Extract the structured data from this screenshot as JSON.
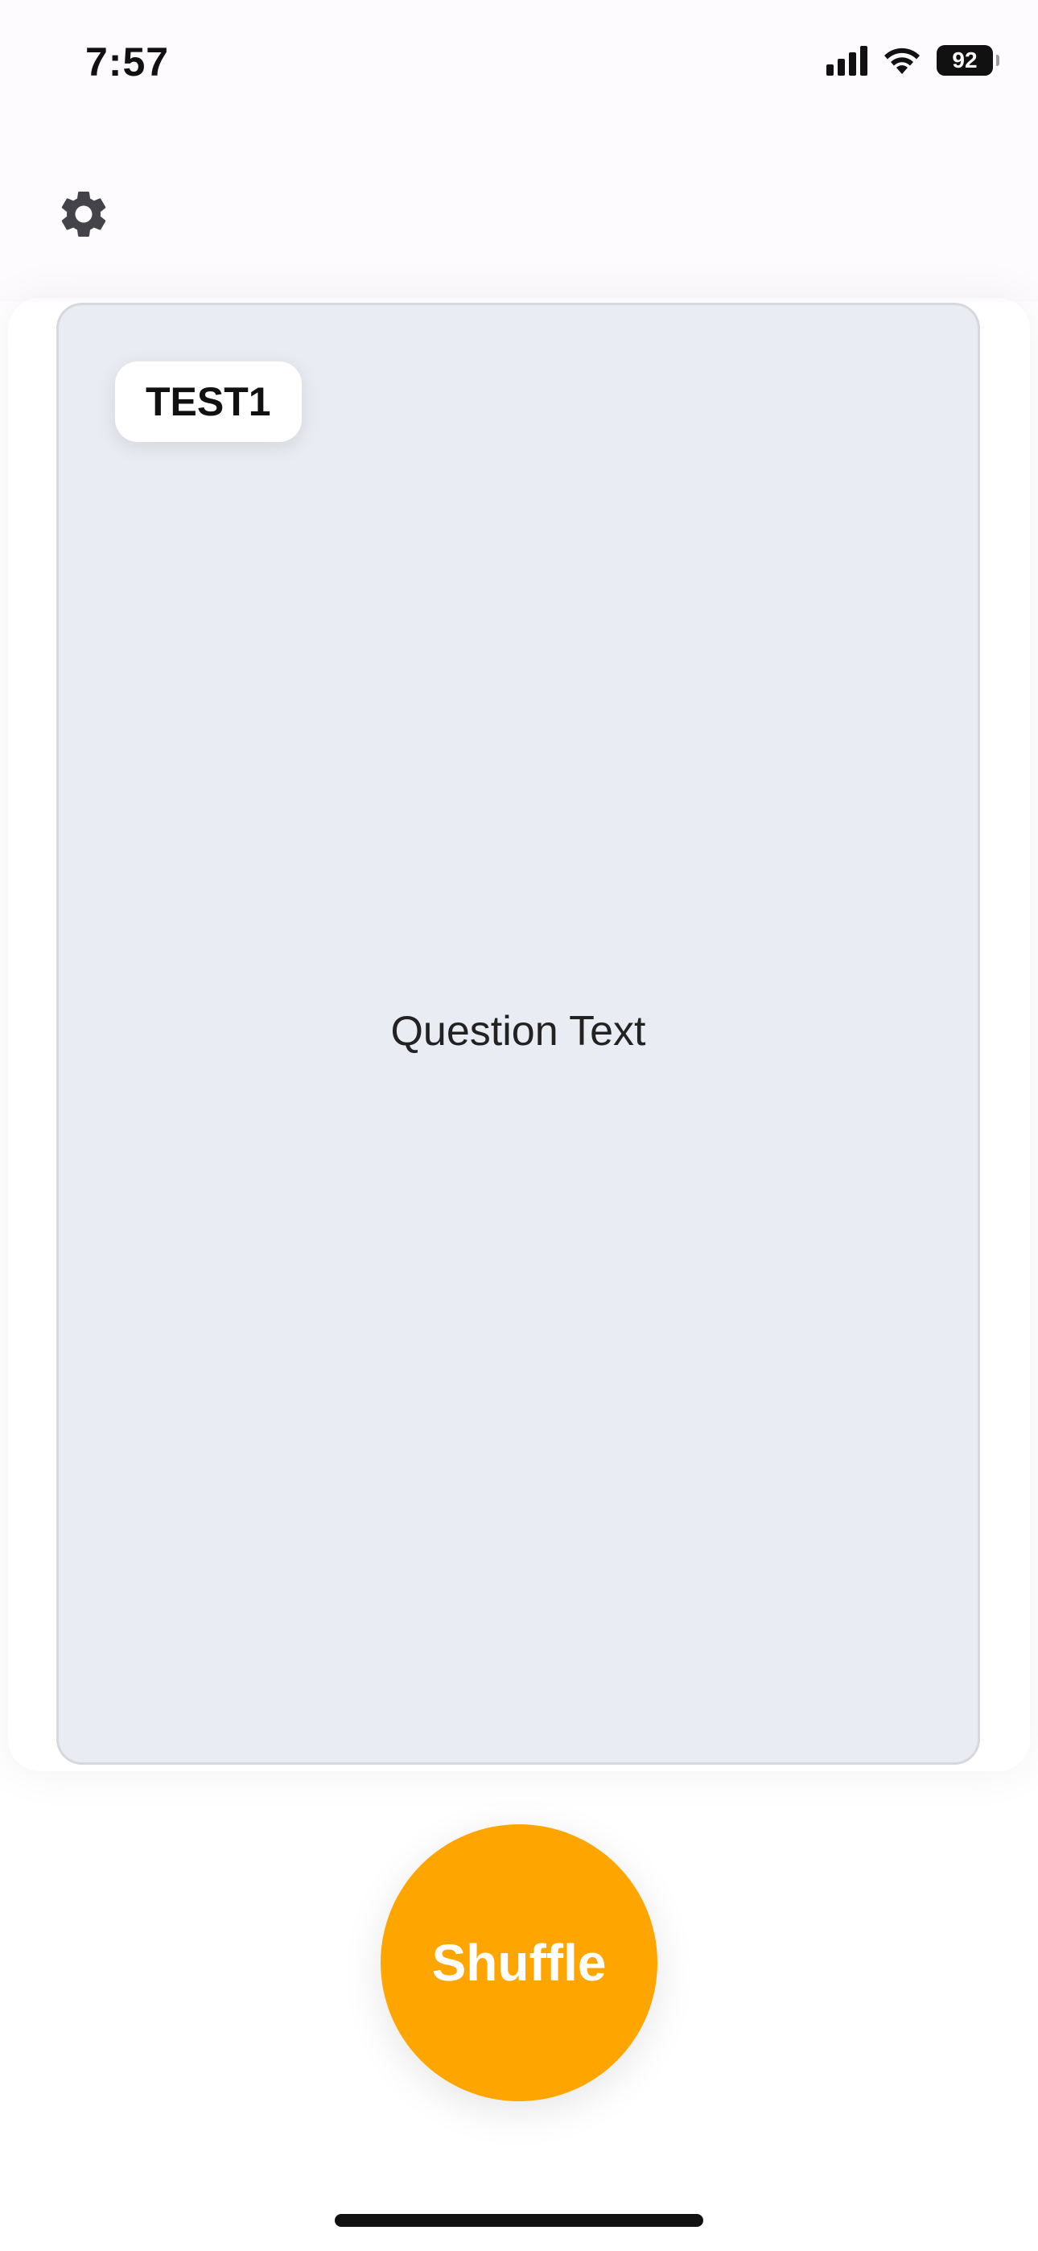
{
  "status_bar": {
    "time": "7:57",
    "battery_level": "92",
    "icons": [
      "cellular-signal-icon",
      "wifi-icon",
      "battery-icon"
    ]
  },
  "header": {
    "settings_icon": "gear-icon"
  },
  "card": {
    "category_label": "TEST1",
    "question": "Question Text"
  },
  "actions": {
    "shuffle_label": "Shuffle"
  },
  "colors": {
    "accent": "#fea500",
    "card_background": "#e9ecf2",
    "top_background": "#fefbfe"
  }
}
